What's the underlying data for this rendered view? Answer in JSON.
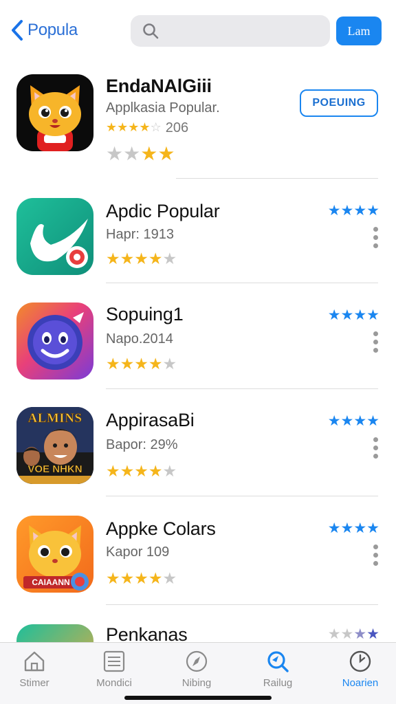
{
  "nav": {
    "back_label": "Popula",
    "search_placeholder": "",
    "button_label": "Lam"
  },
  "apps": [
    {
      "title": "EndaNAlGiii",
      "subtitle": "Applkasia Popular.",
      "rating_text": "206",
      "action_label": "POEUING"
    },
    {
      "title": "Apdic Popular",
      "subtitle": "Hapr: 1913"
    },
    {
      "title": "Sopuing1",
      "subtitle": "Napo.2014"
    },
    {
      "title": "AppirasaBi",
      "subtitle": "Bapor: 29%",
      "icon_text_top": "ALMINS",
      "icon_text_bottom": "VOE NHKN"
    },
    {
      "title": "Appke Colars",
      "subtitle": "Kapor 109",
      "icon_text": "CAIAANN"
    },
    {
      "title": "Penkanas"
    }
  ],
  "tabs": [
    {
      "label": "Stimer",
      "icon": "home-icon"
    },
    {
      "label": "Mondici",
      "icon": "list-icon"
    },
    {
      "label": "Nibing",
      "icon": "compass-icon"
    },
    {
      "label": "Railug",
      "icon": "search-icon"
    },
    {
      "label": "Noarien",
      "icon": "clock-icon"
    }
  ],
  "colors": {
    "accent": "#1a86f0",
    "star": "#f5b51b",
    "star_off": "#c7c7c7"
  }
}
